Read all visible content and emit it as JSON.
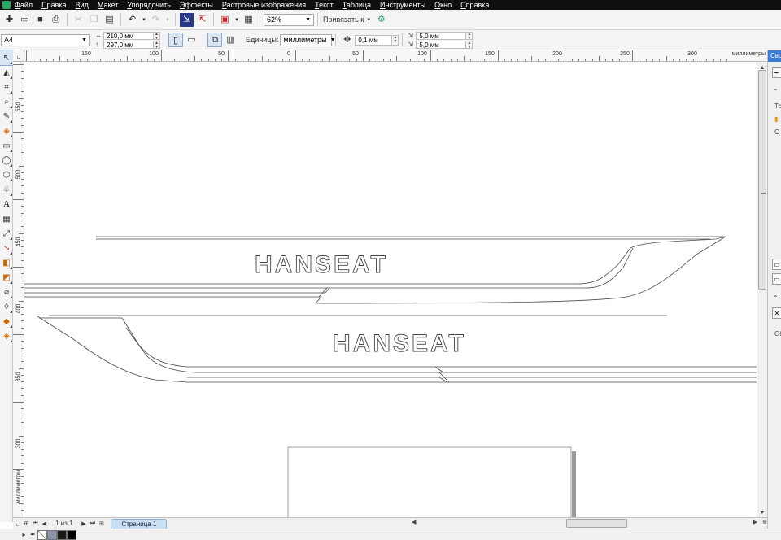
{
  "menu": [
    "Файл",
    "Правка",
    "Вид",
    "Макет",
    "Упорядочить",
    "Эффекты",
    "Растровые изображения",
    "Текст",
    "Таблица",
    "Инструменты",
    "Окно",
    "Справка"
  ],
  "toolbar": {
    "zoom": "62%",
    "snap_label": "Привязать к"
  },
  "property_bar": {
    "page_size": "A4",
    "width": "210,0 мм",
    "height": "297,0 мм",
    "units_label": "Единицы:",
    "units_value": "миллиметры",
    "nudge": "0,1 мм",
    "dup_x": "5,0 мм",
    "dup_y": "5,0 мм"
  },
  "ruler": {
    "horizontal_labels": [
      "150",
      "100",
      "50",
      "0",
      "50",
      "100",
      "150",
      "200",
      "250",
      "300"
    ],
    "vertical_labels": [
      "550",
      "500",
      "450",
      "400",
      "350",
      "300"
    ],
    "unit": "миллиметры"
  },
  "artwork": {
    "text_top": "HANSEAT",
    "text_bottom": "HANSEAT"
  },
  "page_nav": {
    "counter": "1 из 1",
    "page_tab": "Страница 1"
  },
  "docker": {
    "tab": "Свойства",
    "label_1": "Тс",
    "label_2": "С",
    "label_3": "Об"
  },
  "colors": {
    "menubar": "#0f0f0f",
    "accent": "#3a7bd5",
    "page_tab": "#c9dff4"
  },
  "status_swatches": [
    "#8a94a8",
    "#1a1a1a",
    "#000000"
  ]
}
